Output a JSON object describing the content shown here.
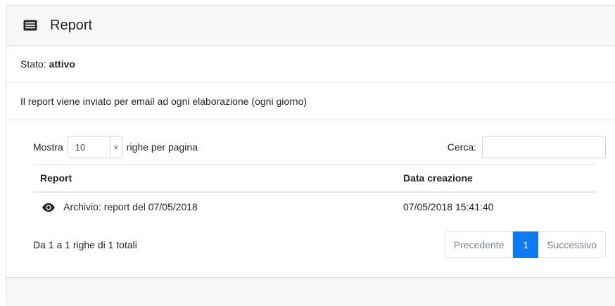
{
  "panel": {
    "title": "Report",
    "icon": "list-card-icon"
  },
  "status": {
    "label": "Stato:",
    "value": "attivo"
  },
  "info": "Il report viene inviato per email ad ogni elaborazione (ogni giorno)",
  "controls": {
    "show_label": "Mostra",
    "page_size": "10",
    "rows_label": "righe per pagina",
    "search_label": "Cerca:",
    "search_value": ""
  },
  "table": {
    "columns": [
      "Report",
      "Data creazione"
    ],
    "rows": [
      {
        "icon": "eye-icon",
        "report": "Archivio: report del 07/05/2018",
        "date": "07/05/2018 15:41:40"
      }
    ]
  },
  "footer": {
    "summary": "Da 1 a 1 righe di 1 totali",
    "prev": "Precedente",
    "page": "1",
    "next": "Successivo"
  },
  "colors": {
    "accent": "#0d7bf2"
  }
}
